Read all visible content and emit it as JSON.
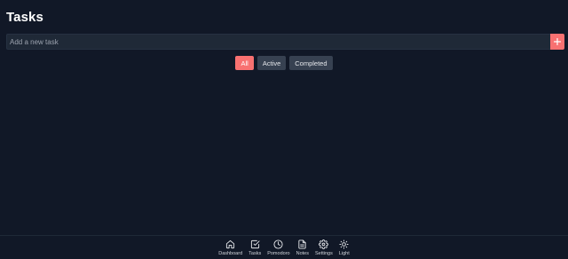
{
  "page": {
    "title": "Tasks"
  },
  "task_input": {
    "placeholder": "Add a new task",
    "value": "",
    "add_label": "+"
  },
  "filters": [
    {
      "label": "All",
      "active": true
    },
    {
      "label": "Active",
      "active": false
    },
    {
      "label": "Completed",
      "active": false
    }
  ],
  "nav": {
    "items": [
      {
        "label": "Dashboard",
        "icon": "home-icon"
      },
      {
        "label": "Tasks",
        "icon": "checkbox-icon"
      },
      {
        "label": "Pomodoro",
        "icon": "clock-icon"
      },
      {
        "label": "Notes",
        "icon": "document-icon"
      },
      {
        "label": "Settings",
        "icon": "gear-icon"
      },
      {
        "label": "Light",
        "icon": "sun-icon"
      }
    ]
  },
  "colors": {
    "background": "#111827",
    "accent": "#f87171",
    "input_bg": "#1f2937",
    "button_bg": "#374151"
  }
}
